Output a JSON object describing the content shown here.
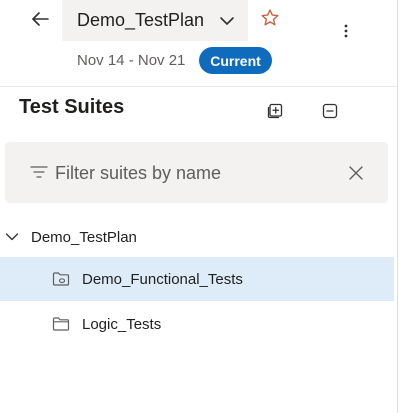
{
  "header": {
    "plan_name": "Demo_TestPlan",
    "date_range": "Nov 14 - Nov 21",
    "status_badge": "Current"
  },
  "suites_panel": {
    "title": "Test Suites",
    "filter": {
      "placeholder": "Filter suites by name",
      "value": ""
    }
  },
  "tree": {
    "root": {
      "label": "Demo_TestPlan",
      "expanded": true
    },
    "children": [
      {
        "label": "Demo_Functional_Tests",
        "selected": true,
        "icon": "suite-folder-icon"
      },
      {
        "label": "Logic_Tests",
        "selected": false,
        "icon": "folder-icon"
      }
    ]
  },
  "colors": {
    "accent": "#0f6cbd",
    "selected_row": "#deecf9",
    "panel_bg": "#f3f2f1",
    "star": "#c8643b"
  }
}
